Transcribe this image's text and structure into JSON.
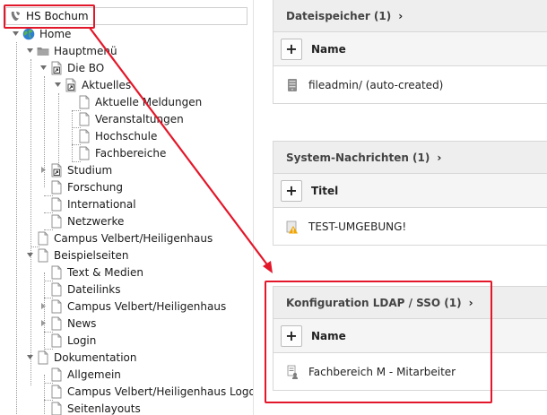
{
  "tree": {
    "root_label": "HS Bochum",
    "root_icon": "typo3-logo-icon",
    "items": [
      {
        "label": "Home",
        "icon": "globe-icon"
      },
      {
        "label": "Hauptmenü",
        "icon": "folder-icon"
      },
      {
        "label": "Die BO",
        "icon": "shortcut-page-icon"
      },
      {
        "label": "Aktuelles",
        "icon": "shortcut-page-icon"
      },
      {
        "label": "Aktuelle Meldungen",
        "icon": "page-icon"
      },
      {
        "label": "Veranstaltungen",
        "icon": "page-icon"
      },
      {
        "label": "Hochschule",
        "icon": "page-icon"
      },
      {
        "label": "Fachbereiche",
        "icon": "page-icon"
      },
      {
        "label": "Studium",
        "icon": "shortcut-page-icon"
      },
      {
        "label": "Forschung",
        "icon": "page-icon"
      },
      {
        "label": "International",
        "icon": "page-icon"
      },
      {
        "label": "Netzwerke",
        "icon": "page-icon"
      },
      {
        "label": "Campus Velbert/Heiligenhaus",
        "icon": "page-icon"
      },
      {
        "label": "Beispielseiten",
        "icon": "page-icon"
      },
      {
        "label": "Text & Medien",
        "icon": "page-icon"
      },
      {
        "label": "Dateilinks",
        "icon": "page-icon"
      },
      {
        "label": "Campus Velbert/Heiligenhaus",
        "icon": "page-icon"
      },
      {
        "label": "News",
        "icon": "page-icon"
      },
      {
        "label": "Login",
        "icon": "page-icon"
      },
      {
        "label": "Dokumentation",
        "icon": "page-icon"
      },
      {
        "label": "Allgemein",
        "icon": "page-icon"
      },
      {
        "label": "Campus Velbert/Heiligenhaus Logo",
        "icon": "page-icon"
      },
      {
        "label": "Seitenlayouts",
        "icon": "page-icon"
      }
    ]
  },
  "panels": [
    {
      "title": "Dateispeicher (1)",
      "chevron": "›",
      "add": "+",
      "column": "Name",
      "row_icon": "storage-icon",
      "row": "fileadmin/ (auto-created)"
    },
    {
      "title": "System-Nachrichten (1)",
      "chevron": "›",
      "add": "+",
      "column": "Titel",
      "row_icon": "warning-icon",
      "row": "TEST-UMGEBUNG!"
    },
    {
      "title": "Konfiguration LDAP / SSO (1)",
      "chevron": "›",
      "add": "+",
      "column": "Name",
      "row_icon": "ldap-config-icon",
      "row": "Fachbereich M - Mitarbeiter"
    }
  ],
  "colors": {
    "highlight": "#e3172a",
    "panel_header": "#eeeeee",
    "typo3_orange": "#f49700",
    "globe_blue": "#2f7fd1"
  }
}
